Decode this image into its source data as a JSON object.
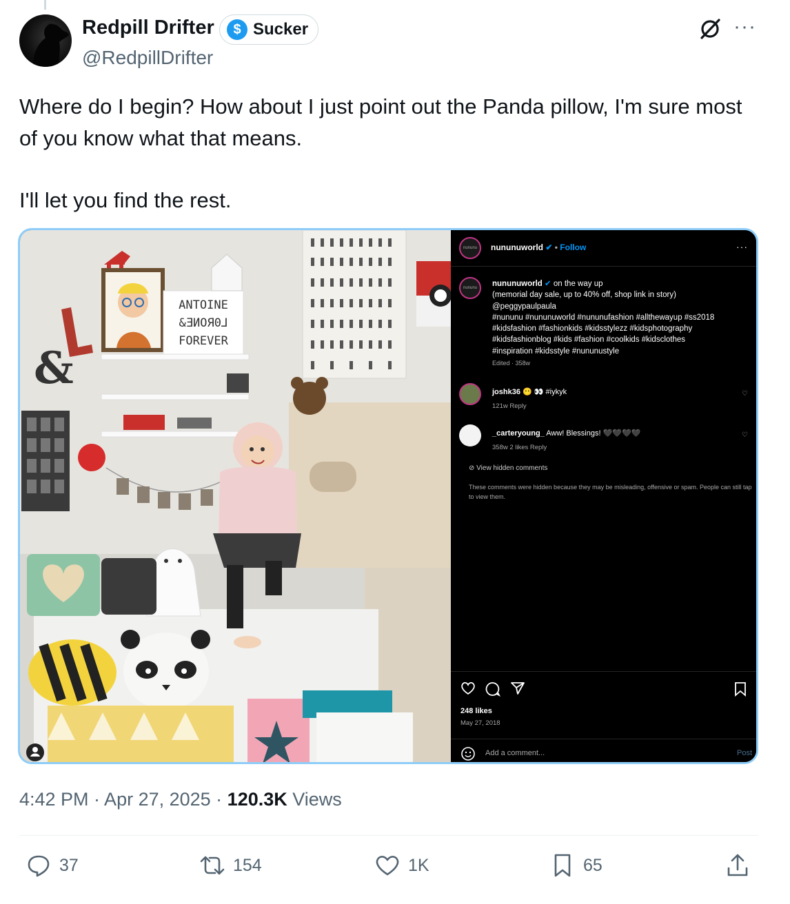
{
  "author": {
    "name": "Redpill Drifter",
    "handle": "@RedpillDrifter",
    "badge_label": "Sucker",
    "badge_symbol": "$"
  },
  "tweet": {
    "paragraph_1": "Where do I begin? How about I just point out the Panda pillow, I'm sure most of you know what that means.",
    "paragraph_2": "I'll let you find the rest."
  },
  "photo": {
    "letterboard_line_1": "ANTOINE",
    "letterboard_line_2": "&ƎИOЯ0⅃",
    "letterboard_line_3": "FOREVER",
    "ampersand": "&"
  },
  "instagram": {
    "logo_text": "nununu",
    "header_user": "nununuworld",
    "follow_label": "Follow",
    "caption_user": "nununuworld",
    "caption_lines": [
      "on the way up",
      "(memorial day sale, up to 40% off, shop link in story)",
      "@peggypaulpaula",
      "#nununu #nununuworld #nununufashion #allthewayup #ss2018",
      "#kidsfashion #fashionkids #kidsstylezz #kidsphotography",
      "#kidsfashionblog #kids #fashion #coolkids #kidsclothes",
      "#inspiration #kidsstyle #nununustyle"
    ],
    "edited": "Edited · 358w",
    "comments": [
      {
        "user": "joshk36",
        "text": "😶 👀 #iykyk",
        "meta": "121w   Reply"
      },
      {
        "user": "_carteryoung_",
        "text": "Aww! Blessings! 🖤🖤🖤🖤",
        "meta": "358w   2 likes   Reply"
      }
    ],
    "view_hidden": "View hidden comments",
    "hidden_note": "These comments were hidden because they may be misleading, offensive or spam. People can still tap to view them.",
    "likes": "248 likes",
    "date": "May 27, 2018",
    "add_comment_placeholder": "Add a comment...",
    "post_label": "Post"
  },
  "meta": {
    "time": "4:42 PM · Apr 27, 2025 · ",
    "views_count": "120.3K",
    "views_label": " Views"
  },
  "actions": {
    "replies": "37",
    "reposts": "154",
    "likes": "1K",
    "bookmarks": "65"
  },
  "colors": {
    "accent": "#1d9bf0",
    "secondary_text": "#536471",
    "instagram_bg": "#000000"
  }
}
